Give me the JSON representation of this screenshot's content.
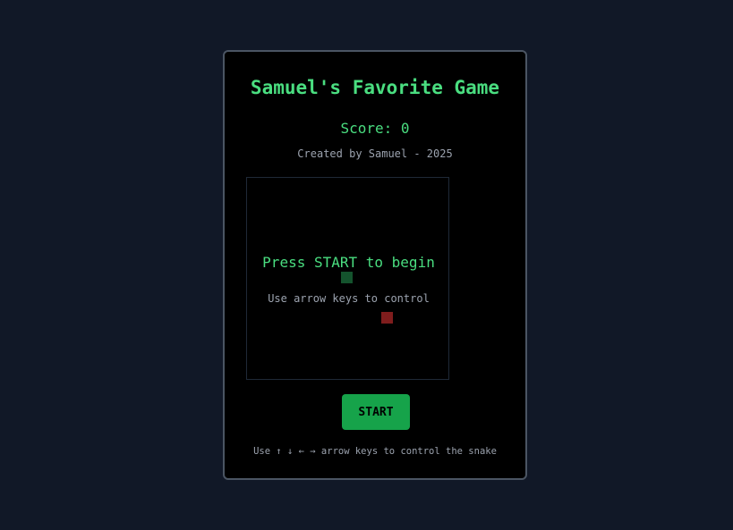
{
  "game": {
    "title": "Samuel's Favorite Game",
    "score_label": "Score:",
    "score_value": "0",
    "credit": "Created by Samuel - 2025"
  },
  "board": {
    "overlay_title": "Press START to begin",
    "overlay_subtitle": "Use arrow keys to control",
    "snake_color": "#14532d",
    "food_color": "#7f1d1d"
  },
  "controls": {
    "start_label": "START",
    "help_text": "Use ↑ ↓ ← → arrow keys to control the snake"
  },
  "colors": {
    "accent": "#4ade80",
    "button": "#16a34a",
    "background": "#111827",
    "card": "#000000",
    "muted_text": "#9ca3af"
  }
}
